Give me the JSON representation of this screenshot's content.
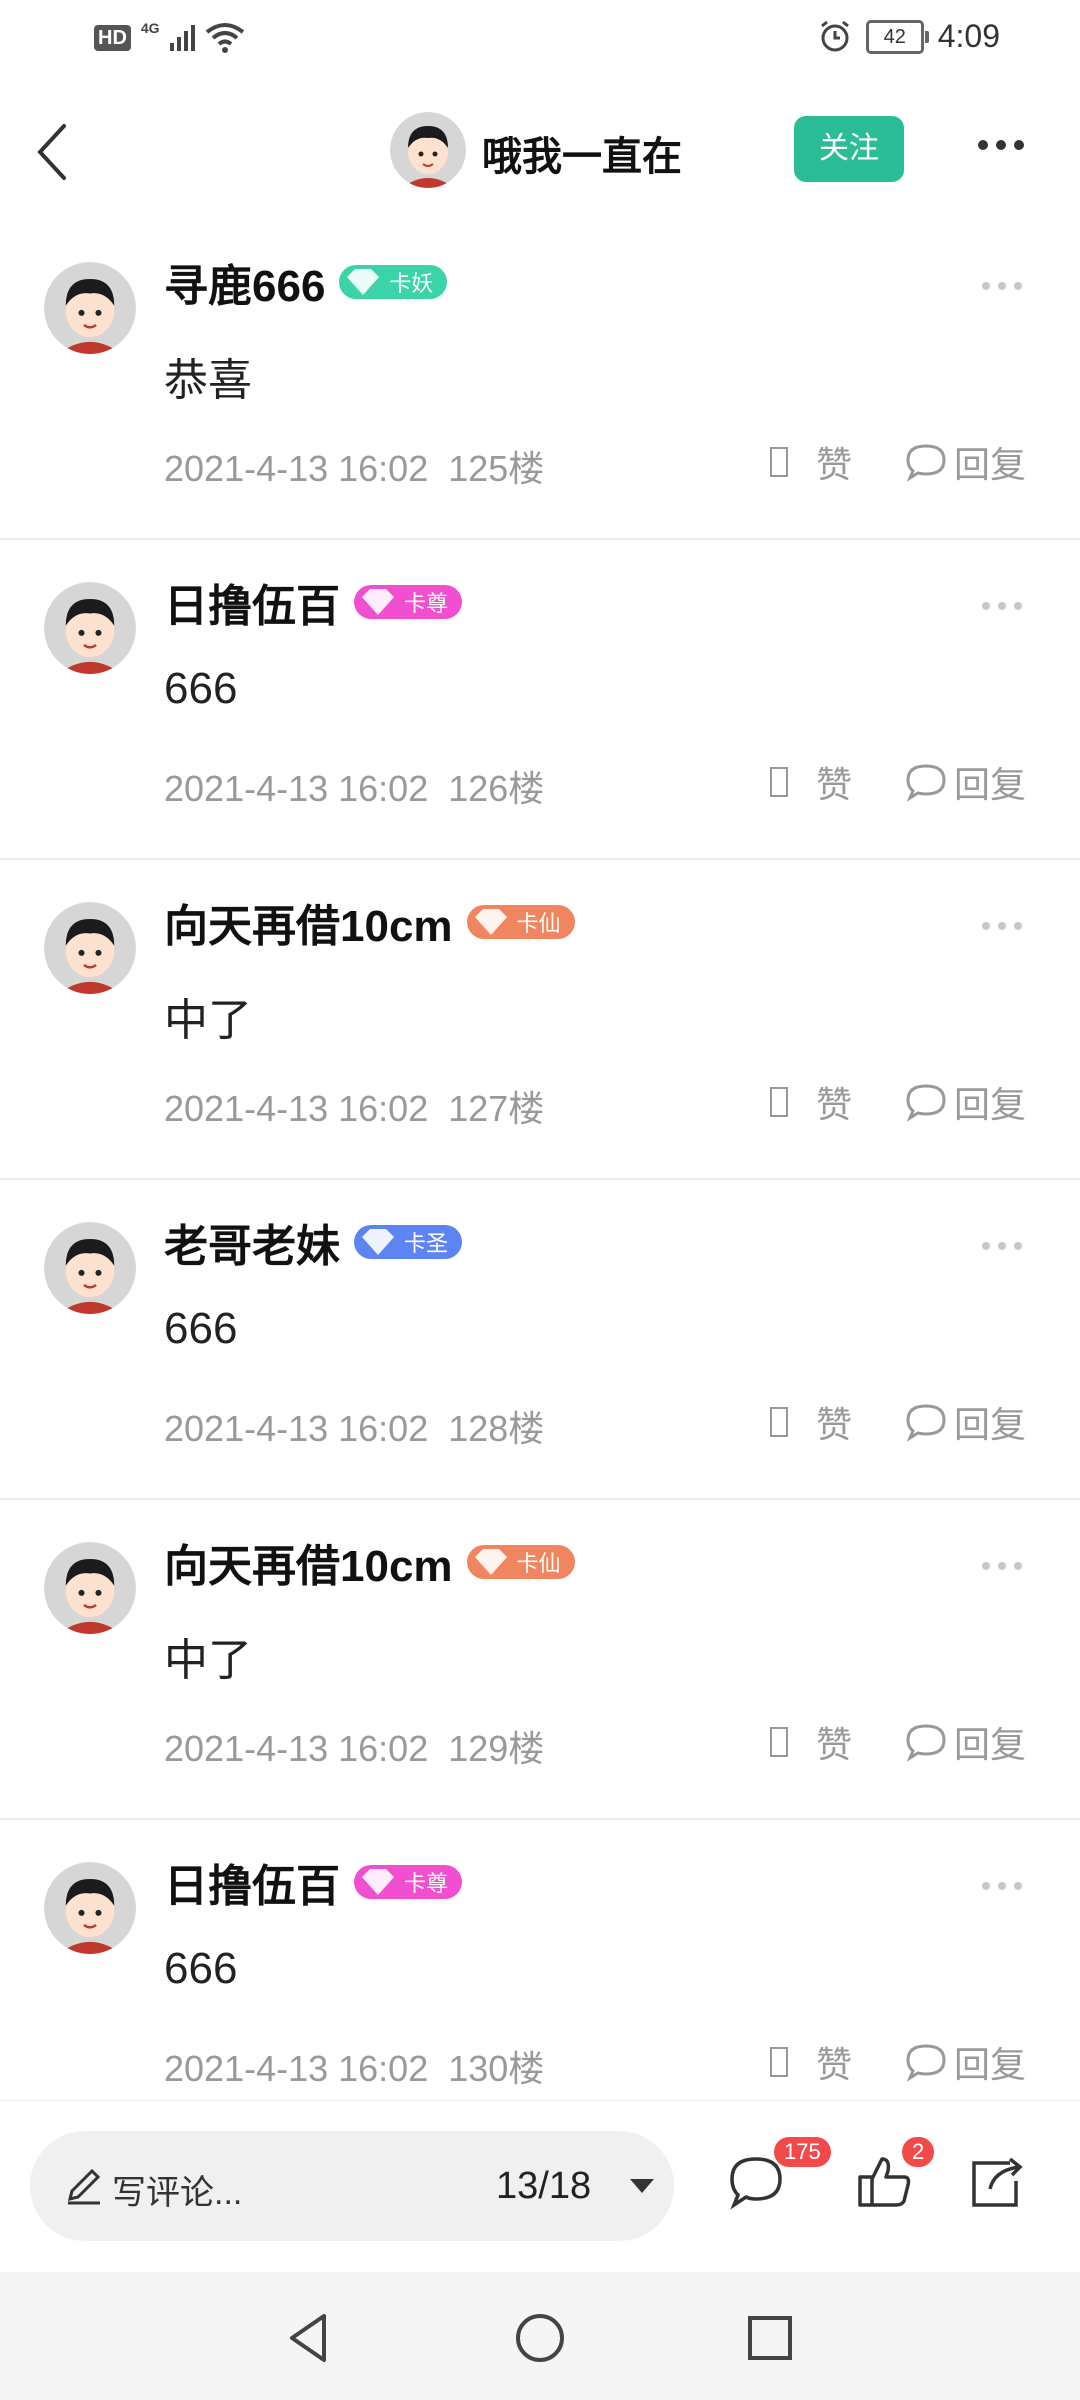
{
  "status_bar": {
    "left": {
      "hd": "HD",
      "network": "4G"
    },
    "right": {
      "battery": "42",
      "time": "4:09"
    }
  },
  "header": {
    "title": "哦我一直在",
    "follow_label": "关注"
  },
  "comments": [
    {
      "name": "寻鹿666",
      "badge": "卡妖",
      "badge_color": "#3bd3a8",
      "content": "恭喜",
      "date": "2021-4-13 16:02",
      "floor": "125楼",
      "like_label": "赞",
      "reply_label": "回复"
    },
    {
      "name": "日撸伍百",
      "badge": "卡尊",
      "badge_color": "#f24fd0",
      "content": "666",
      "date": "2021-4-13 16:02",
      "floor": "126楼",
      "like_label": "赞",
      "reply_label": "回复"
    },
    {
      "name": "向天再借10cm",
      "badge": "卡仙",
      "badge_color": "#f08560",
      "content": "中了",
      "date": "2021-4-13 16:02",
      "floor": "127楼",
      "like_label": "赞",
      "reply_label": "回复"
    },
    {
      "name": "老哥老妹",
      "badge": "卡圣",
      "badge_color": "#5c84f2",
      "content": "666",
      "date": "2021-4-13 16:02",
      "floor": "128楼",
      "like_label": "赞",
      "reply_label": "回复"
    },
    {
      "name": "向天再借10cm",
      "badge": "卡仙",
      "badge_color": "#f08560",
      "content": "中了",
      "date": "2021-4-13 16:02",
      "floor": "129楼",
      "like_label": "赞",
      "reply_label": "回复"
    },
    {
      "name": "日撸伍百",
      "badge": "卡尊",
      "badge_color": "#f24fd0",
      "content": "666",
      "date": "2021-4-13 16:02",
      "floor": "130楼",
      "like_label": "赞",
      "reply_label": "回复"
    }
  ],
  "bottom_bar": {
    "write_placeholder": "写评论...",
    "pager": "13/18",
    "comment_count": "175",
    "like_count": "2"
  },
  "colors": {
    "accent": "#2bbd97",
    "badge_red": "#f24a4a"
  }
}
